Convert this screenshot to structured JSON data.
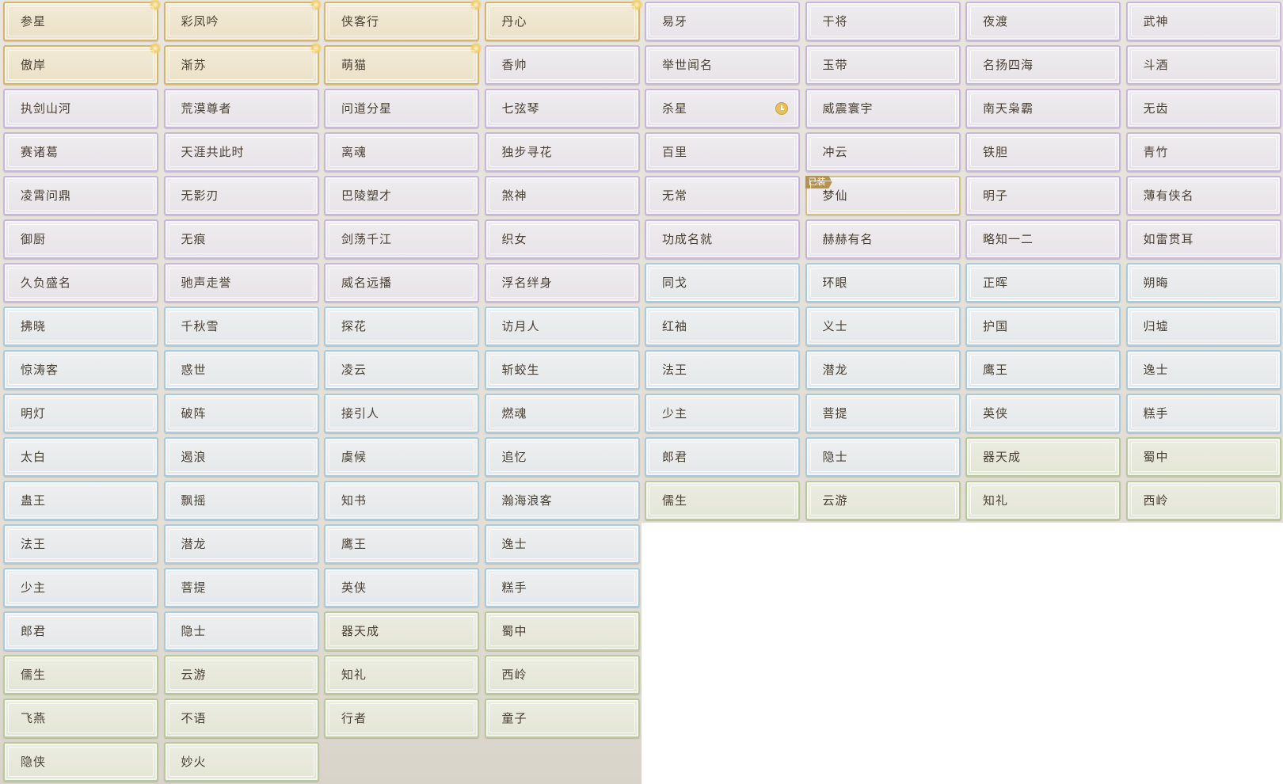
{
  "tiers": {
    "gold": "#d9b46a",
    "purple": "#c8b6dc",
    "blue": "#a9cbe0",
    "green": "#b8c99a"
  },
  "badges": {
    "equipped": "已装"
  },
  "right_grid": {
    "rows": [
      [
        {
          "label": "易牙",
          "tier": "purple"
        },
        {
          "label": "干将",
          "tier": "purple"
        },
        {
          "label": "夜渡",
          "tier": "purple"
        },
        {
          "label": "武神",
          "tier": "purple"
        }
      ],
      [
        {
          "label": "举世闻名",
          "tier": "purple"
        },
        {
          "label": "玉带",
          "tier": "purple"
        },
        {
          "label": "名扬四海",
          "tier": "purple"
        },
        {
          "label": "斗酒",
          "tier": "purple"
        }
      ],
      [
        {
          "label": "杀星",
          "tier": "purple",
          "icon": "clock-icon"
        },
        {
          "label": "威震寰宇",
          "tier": "purple"
        },
        {
          "label": "南天枭霸",
          "tier": "purple"
        },
        {
          "label": "无齿",
          "tier": "purple"
        }
      ],
      [
        {
          "label": "百里",
          "tier": "purple"
        },
        {
          "label": "冲云",
          "tier": "purple"
        },
        {
          "label": "铁胆",
          "tier": "purple"
        },
        {
          "label": "青竹",
          "tier": "purple"
        }
      ],
      [
        {
          "label": "无常",
          "tier": "purple"
        },
        {
          "label": "梦仙",
          "tier": "purple",
          "equipped": true
        },
        {
          "label": "明子",
          "tier": "purple"
        },
        {
          "label": "薄有侠名",
          "tier": "purple"
        }
      ],
      [
        {
          "label": "功成名就",
          "tier": "purple"
        },
        {
          "label": "赫赫有名",
          "tier": "purple"
        },
        {
          "label": "略知一二",
          "tier": "purple"
        },
        {
          "label": "如雷贯耳",
          "tier": "purple"
        }
      ],
      [
        {
          "label": "同戈",
          "tier": "blue"
        },
        {
          "label": "环眼",
          "tier": "blue"
        },
        {
          "label": "正晖",
          "tier": "blue"
        },
        {
          "label": "朔晦",
          "tier": "blue"
        }
      ],
      [
        {
          "label": "红袖",
          "tier": "blue"
        },
        {
          "label": "义士",
          "tier": "blue"
        },
        {
          "label": "护国",
          "tier": "blue"
        },
        {
          "label": "归墟",
          "tier": "blue"
        }
      ],
      [
        {
          "label": "法王",
          "tier": "blue"
        },
        {
          "label": "潜龙",
          "tier": "blue"
        },
        {
          "label": "鹰王",
          "tier": "blue"
        },
        {
          "label": "逸士",
          "tier": "blue"
        }
      ],
      [
        {
          "label": "少主",
          "tier": "blue"
        },
        {
          "label": "菩提",
          "tier": "blue"
        },
        {
          "label": "英侠",
          "tier": "blue"
        },
        {
          "label": "糕手",
          "tier": "blue"
        }
      ],
      [
        {
          "label": "郎君",
          "tier": "blue"
        },
        {
          "label": "隐士",
          "tier": "blue"
        },
        {
          "label": "器天成",
          "tier": "green"
        },
        {
          "label": "蜀中",
          "tier": "green"
        }
      ],
      [
        {
          "label": "儒生",
          "tier": "green"
        },
        {
          "label": "云游",
          "tier": "green"
        },
        {
          "label": "知礼",
          "tier": "green"
        },
        {
          "label": "西岭",
          "tier": "green"
        }
      ]
    ]
  },
  "left_grid": {
    "rows": [
      [
        {
          "label": "参星",
          "tier": "gold"
        },
        {
          "label": "彩凤吟",
          "tier": "gold"
        },
        {
          "label": "侠客行",
          "tier": "gold"
        },
        {
          "label": "丹心",
          "tier": "gold"
        }
      ],
      [
        {
          "label": "傲岸",
          "tier": "gold"
        },
        {
          "label": "渐苏",
          "tier": "gold"
        },
        {
          "label": "萌猫",
          "tier": "gold"
        },
        {
          "label": "香帅",
          "tier": "purple"
        }
      ],
      [
        {
          "label": "执剑山河",
          "tier": "purple"
        },
        {
          "label": "荒漠尊者",
          "tier": "purple"
        },
        {
          "label": "问道分星",
          "tier": "purple"
        },
        {
          "label": "七弦琴",
          "tier": "purple"
        }
      ],
      [
        {
          "label": "赛诸葛",
          "tier": "purple"
        },
        {
          "label": "天涯共此时",
          "tier": "purple"
        },
        {
          "label": "离魂",
          "tier": "purple"
        },
        {
          "label": "独步寻花",
          "tier": "purple"
        }
      ],
      [
        {
          "label": "凌霄问鼎",
          "tier": "purple"
        },
        {
          "label": "无影刃",
          "tier": "purple"
        },
        {
          "label": "巴陵塑才",
          "tier": "purple"
        },
        {
          "label": "煞神",
          "tier": "purple"
        }
      ],
      [
        {
          "label": "御厨",
          "tier": "purple"
        },
        {
          "label": "无痕",
          "tier": "purple"
        },
        {
          "label": "剑荡千江",
          "tier": "purple"
        },
        {
          "label": "织女",
          "tier": "purple"
        }
      ],
      [
        {
          "label": "久负盛名",
          "tier": "purple"
        },
        {
          "label": "驰声走誉",
          "tier": "purple"
        },
        {
          "label": "威名远播",
          "tier": "purple"
        },
        {
          "label": "浮名绊身",
          "tier": "purple"
        }
      ],
      [
        {
          "label": "拂晓",
          "tier": "blue"
        },
        {
          "label": "千秋雪",
          "tier": "blue"
        },
        {
          "label": "探花",
          "tier": "blue"
        },
        {
          "label": "访月人",
          "tier": "blue"
        }
      ],
      [
        {
          "label": "惊涛客",
          "tier": "blue"
        },
        {
          "label": "惑世",
          "tier": "blue"
        },
        {
          "label": "凌云",
          "tier": "blue"
        },
        {
          "label": "斩蛟生",
          "tier": "blue"
        }
      ],
      [
        {
          "label": "明灯",
          "tier": "blue"
        },
        {
          "label": "破阵",
          "tier": "blue"
        },
        {
          "label": "接引人",
          "tier": "blue"
        },
        {
          "label": "燃魂",
          "tier": "blue"
        }
      ],
      [
        {
          "label": "太白",
          "tier": "blue"
        },
        {
          "label": "遏浪",
          "tier": "blue"
        },
        {
          "label": "虞候",
          "tier": "blue"
        },
        {
          "label": "追忆",
          "tier": "blue"
        }
      ],
      [
        {
          "label": "蛊王",
          "tier": "blue"
        },
        {
          "label": "飘摇",
          "tier": "blue"
        },
        {
          "label": "知书",
          "tier": "blue"
        },
        {
          "label": "瀚海浪客",
          "tier": "blue"
        }
      ],
      [
        {
          "label": "法王",
          "tier": "blue"
        },
        {
          "label": "潜龙",
          "tier": "blue"
        },
        {
          "label": "鹰王",
          "tier": "blue"
        },
        {
          "label": "逸士",
          "tier": "blue"
        }
      ],
      [
        {
          "label": "少主",
          "tier": "blue"
        },
        {
          "label": "菩提",
          "tier": "blue"
        },
        {
          "label": "英侠",
          "tier": "blue"
        },
        {
          "label": "糕手",
          "tier": "blue"
        }
      ],
      [
        {
          "label": "郎君",
          "tier": "blue"
        },
        {
          "label": "隐士",
          "tier": "blue"
        },
        {
          "label": "器天成",
          "tier": "green"
        },
        {
          "label": "蜀中",
          "tier": "green"
        }
      ],
      [
        {
          "label": "儒生",
          "tier": "green"
        },
        {
          "label": "云游",
          "tier": "green"
        },
        {
          "label": "知礼",
          "tier": "green"
        },
        {
          "label": "西岭",
          "tier": "green"
        }
      ],
      [
        {
          "label": "飞燕",
          "tier": "green"
        },
        {
          "label": "不语",
          "tier": "green"
        },
        {
          "label": "行者",
          "tier": "green"
        },
        {
          "label": "童子",
          "tier": "green"
        }
      ],
      [
        {
          "label": "隐侠",
          "tier": "green"
        },
        {
          "label": "妙火",
          "tier": "green"
        }
      ]
    ]
  }
}
